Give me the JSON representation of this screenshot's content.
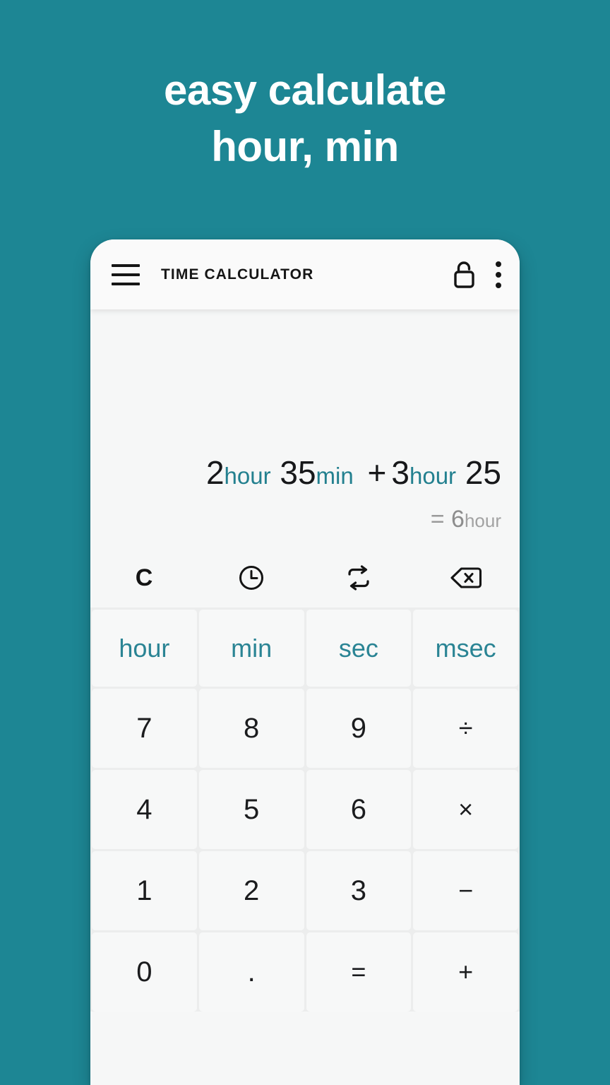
{
  "promo": {
    "headline_line1": "easy calculate",
    "headline_line2": "hour, min",
    "background_color": "#1d8694",
    "text_color": "#ffffff"
  },
  "appbar": {
    "title": "TIME CALCULATOR",
    "menu_icon": "hamburger-menu-icon",
    "lock_icon": "unlock-open-padlock-icon",
    "overflow_icon": "more-vertical-kebab-icon"
  },
  "display": {
    "expression_tokens": [
      {
        "text": "2",
        "kind": "number"
      },
      {
        "text": "hour",
        "kind": "unit"
      },
      {
        "text": "35",
        "kind": "number"
      },
      {
        "text": "min",
        "kind": "unit"
      },
      {
        "text": "+",
        "kind": "operator"
      },
      {
        "text": "3",
        "kind": "number"
      },
      {
        "text": "hour",
        "kind": "unit"
      },
      {
        "text": "25",
        "kind": "number"
      }
    ],
    "expression_plain": "2 hour 35 min + 3 hour 25",
    "result_equals": "=",
    "result_value": "6",
    "result_unit": "hour",
    "result_plain": "= 6 hour",
    "unit_color": "#23808f",
    "result_color": "#9a9a9a"
  },
  "function_row": [
    {
      "label": "C",
      "name": "clear-button",
      "icon": "letter-c"
    },
    {
      "label": "",
      "name": "clock-button",
      "icon": "clock-icon"
    },
    {
      "label": "",
      "name": "swap-button",
      "icon": "swap-repeat-arrows-icon"
    },
    {
      "label": "",
      "name": "backspace-button",
      "icon": "backspace-delete-icon"
    }
  ],
  "keypad": {
    "unit_row": [
      "hour",
      "min",
      "sec",
      "msec"
    ],
    "rows": [
      [
        "7",
        "8",
        "9",
        "÷"
      ],
      [
        "4",
        "5",
        "6",
        "×"
      ],
      [
        "1",
        "2",
        "3",
        "−"
      ],
      [
        "0",
        ".",
        "=",
        "+"
      ]
    ],
    "unit_text_color": "#2a8494",
    "key_background": "#f7f8f8",
    "keypad_background": "#eceded"
  }
}
